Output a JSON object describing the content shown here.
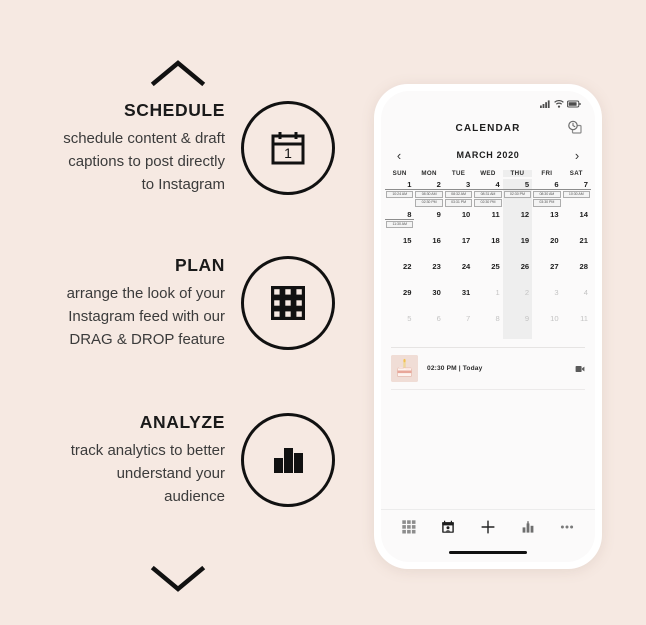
{
  "theme": {
    "background": "#f6e9e2",
    "ink": "#1a1a1a",
    "body_text": "#3b3b3b",
    "phone_frame": "#ffffff",
    "phone_screen": "#fbfafa",
    "chip_border": "#adadad",
    "thumb_bg": "#f0ddd6"
  },
  "decor": {
    "chevron_up": "chevron-up-icon",
    "chevron_down": "chevron-down-icon"
  },
  "features": [
    {
      "title": "SCHEDULE",
      "lines": [
        "schedule content & draft",
        "captions to post directly",
        "to Instagram"
      ],
      "icon": "calendar-icon",
      "icon_day_label": "1"
    },
    {
      "title": "PLAN",
      "lines": [
        "arrange the look of your",
        "Instagram feed with our",
        "DRAG & DROP feature"
      ],
      "icon": "grid-icon"
    },
    {
      "title": "ANALYZE",
      "lines": [
        "track analytics to better",
        "understand your",
        "audience"
      ],
      "icon": "bar-chart-icon"
    }
  ],
  "phone": {
    "status_bar": {
      "signal": "signal-bars-icon",
      "wifi": "wifi-icon",
      "battery": "battery-icon"
    },
    "header": {
      "title": "CALENDAR",
      "action_icon": "history-card-icon"
    },
    "month_nav": {
      "prev": "‹",
      "next": "›",
      "label": "MARCH 2020"
    },
    "weekdays": [
      "SUN",
      "MON",
      "TUE",
      "WED",
      "THU",
      "FRI",
      "SAT"
    ],
    "today_column_index": 4,
    "weeks": [
      [
        {
          "day": "1",
          "muted": false,
          "rule": true,
          "chips": [
            "10:24 AM"
          ]
        },
        {
          "day": "2",
          "muted": false,
          "rule": true,
          "chips": [
            "08:30 AM",
            "02:30 PM"
          ]
        },
        {
          "day": "3",
          "muted": false,
          "rule": true,
          "chips": [
            "08:32 AM",
            "03:31 PM"
          ]
        },
        {
          "day": "4",
          "muted": false,
          "rule": true,
          "chips": [
            "08:31 AM",
            "02:30 PM"
          ]
        },
        {
          "day": "5",
          "muted": false,
          "rule": true,
          "chips": [
            "02:30 PM"
          ],
          "today": true
        },
        {
          "day": "6",
          "muted": false,
          "rule": true,
          "chips": [
            "08:30 AM",
            "03:30 PM"
          ]
        },
        {
          "day": "7",
          "muted": false,
          "rule": true,
          "chips": [
            "10:30 AM"
          ]
        }
      ],
      [
        {
          "day": "8",
          "muted": false,
          "rule": true,
          "chips": [
            "11:30 AM"
          ]
        },
        {
          "day": "9",
          "muted": false,
          "rule": false,
          "chips": []
        },
        {
          "day": "10",
          "muted": false,
          "rule": false,
          "chips": []
        },
        {
          "day": "11",
          "muted": false,
          "rule": false,
          "chips": []
        },
        {
          "day": "12",
          "muted": false,
          "rule": false,
          "chips": [],
          "today": true
        },
        {
          "day": "13",
          "muted": false,
          "rule": false,
          "chips": []
        },
        {
          "day": "14",
          "muted": false,
          "rule": false,
          "chips": []
        }
      ],
      [
        {
          "day": "15",
          "muted": false,
          "rule": false,
          "chips": []
        },
        {
          "day": "16",
          "muted": false,
          "rule": false,
          "chips": []
        },
        {
          "day": "17",
          "muted": false,
          "rule": false,
          "chips": []
        },
        {
          "day": "18",
          "muted": false,
          "rule": false,
          "chips": []
        },
        {
          "day": "19",
          "muted": false,
          "rule": false,
          "chips": [],
          "today": true
        },
        {
          "day": "20",
          "muted": false,
          "rule": false,
          "chips": []
        },
        {
          "day": "21",
          "muted": false,
          "rule": false,
          "chips": []
        }
      ],
      [
        {
          "day": "22",
          "muted": false,
          "rule": false,
          "chips": []
        },
        {
          "day": "23",
          "muted": false,
          "rule": false,
          "chips": []
        },
        {
          "day": "24",
          "muted": false,
          "rule": false,
          "chips": []
        },
        {
          "day": "25",
          "muted": false,
          "rule": false,
          "chips": []
        },
        {
          "day": "26",
          "muted": false,
          "rule": false,
          "chips": [],
          "today": true
        },
        {
          "day": "27",
          "muted": false,
          "rule": false,
          "chips": []
        },
        {
          "day": "28",
          "muted": false,
          "rule": false,
          "chips": []
        }
      ],
      [
        {
          "day": "29",
          "muted": false,
          "rule": false,
          "chips": []
        },
        {
          "day": "30",
          "muted": false,
          "rule": false,
          "chips": []
        },
        {
          "day": "31",
          "muted": false,
          "rule": false,
          "chips": []
        },
        {
          "day": "1",
          "muted": true,
          "rule": false,
          "chips": []
        },
        {
          "day": "2",
          "muted": true,
          "rule": false,
          "chips": [],
          "today": true
        },
        {
          "day": "3",
          "muted": true,
          "rule": false,
          "chips": []
        },
        {
          "day": "4",
          "muted": true,
          "rule": false,
          "chips": []
        }
      ],
      [
        {
          "day": "5",
          "muted": true,
          "rule": false,
          "chips": []
        },
        {
          "day": "6",
          "muted": true,
          "rule": false,
          "chips": []
        },
        {
          "day": "7",
          "muted": true,
          "rule": false,
          "chips": []
        },
        {
          "day": "8",
          "muted": true,
          "rule": false,
          "chips": []
        },
        {
          "day": "9",
          "muted": true,
          "rule": false,
          "chips": [],
          "today": true
        },
        {
          "day": "10",
          "muted": true,
          "rule": false,
          "chips": []
        },
        {
          "day": "11",
          "muted": true,
          "rule": false,
          "chips": []
        }
      ]
    ],
    "events": [
      {
        "thumbnail": "cake-photo-thumbnail",
        "time": "02:30 PM",
        "separator": "|",
        "day_label": "Today",
        "meta": "02:30 PM | Today",
        "type_icon": "video-post-icon"
      }
    ],
    "bottom_nav": [
      {
        "icon": "grid-feed-icon",
        "active": false
      },
      {
        "icon": "calendar-icon",
        "active": true
      },
      {
        "icon": "plus-icon",
        "active": false
      },
      {
        "icon": "analytics-icon",
        "active": false
      },
      {
        "icon": "more-dots-icon",
        "active": false
      }
    ]
  }
}
